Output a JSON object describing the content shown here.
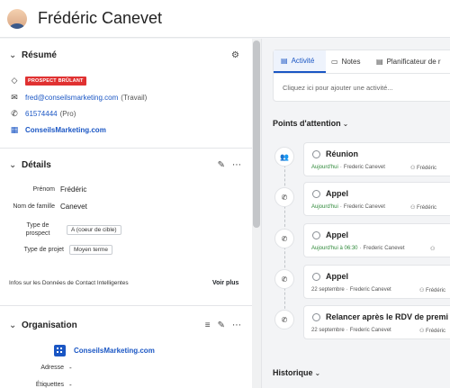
{
  "header": {
    "name": "Frédéric Canevet"
  },
  "resume": {
    "title": "Résumé",
    "badge": "PROSPECT BRÛLANT",
    "email": "fred@conseilsmarketing.com",
    "email_type": "(Travail)",
    "phone": "61574444",
    "phone_type": "(Pro)",
    "company": "ConseilsMarketing.com"
  },
  "details": {
    "title": "Détails",
    "fields": [
      {
        "label": "Prénom",
        "value": "Frédéric"
      },
      {
        "label": "Nom de famille",
        "value": "Canevet"
      },
      {
        "label": "Type de prospect",
        "value": "A (coeur de cible)"
      },
      {
        "label": "Type de projet",
        "value": "Moyen terme"
      }
    ],
    "smart_data": "Infos sur les Données de Contact Intelligentes",
    "see_more": "Voir plus"
  },
  "organisation": {
    "title": "Organisation",
    "company": "ConseilsMarketing.com",
    "address_label": "Adresse",
    "address_value": "-",
    "labels_label": "Étiquettes",
    "labels_value": "-"
  },
  "tabs": [
    {
      "label": "Activité",
      "icon": "calendar-icon",
      "active": true
    },
    {
      "label": "Notes",
      "icon": "note-icon",
      "active": false
    },
    {
      "label": "Planificateur de r",
      "icon": "calendar-icon",
      "active": false
    }
  ],
  "activity_placeholder": "Cliquez ici pour ajouter une activité...",
  "focus_title": "Points d'attention",
  "history_title": "Historique",
  "activities": [
    {
      "title": "Réunion",
      "icon": "people-icon",
      "date": "Aujourd'hui",
      "date_green": true,
      "owner": "Frederic Canevet",
      "person": "Frédéric"
    },
    {
      "title": "Appel",
      "icon": "phone-icon",
      "date": "Aujourd'hui",
      "date_green": true,
      "owner": "Frederic Canevet",
      "person": "Frédéric"
    },
    {
      "title": "Appel",
      "icon": "phone-icon",
      "date": "Aujourd'hui à 06:30",
      "date_green": true,
      "owner": "Frederic Canevet",
      "person": "Frédéric"
    },
    {
      "title": "Appel",
      "icon": "phone-icon",
      "date": "22 septembre",
      "date_green": false,
      "owner": "Frederic Canevet",
      "person": "Frédéric"
    },
    {
      "title": "Relancer après le RDV de premi",
      "icon": "phone-icon",
      "date": "22 septembre",
      "date_green": false,
      "owner": "Frederic Canevet",
      "person": "Frédéric"
    }
  ]
}
